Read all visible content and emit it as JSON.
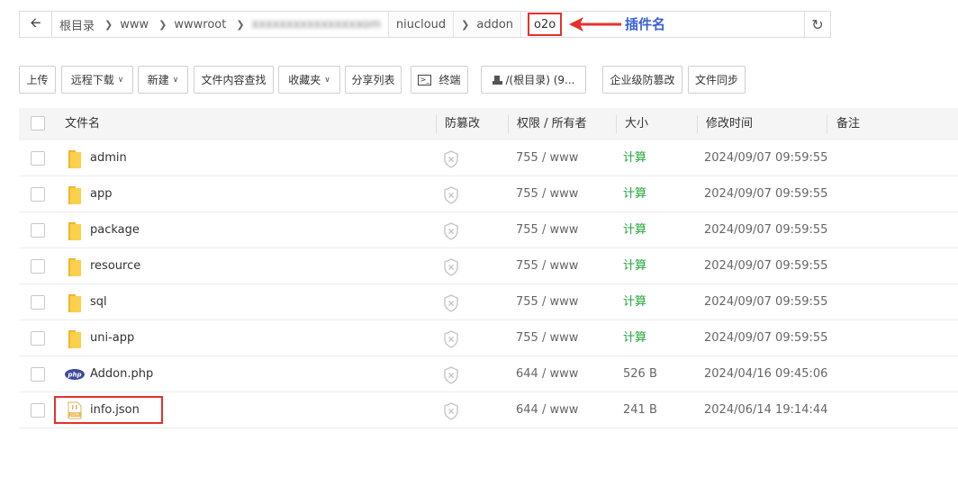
{
  "path": {
    "crumbs": [
      "根目录",
      "www",
      "wwwroot",
      "xxxxxxxxxxxxxxxxom",
      "niucloud",
      "addon",
      "o2o"
    ],
    "annotation": "插件名"
  },
  "toolbar": {
    "upload": "上传",
    "remote_download": "远程下载",
    "new": "新建",
    "content_search": "文件内容查找",
    "favorites": "收藏夹",
    "share_list": "分享列表",
    "terminal": "终端",
    "disk": "/(根目录) (9...",
    "tamper": "企业级防篡改",
    "sync": "文件同步"
  },
  "table": {
    "headers": {
      "name": "文件名",
      "tamper": "防篡改",
      "perm": "权限 / 所有者",
      "size": "大小",
      "mtime": "修改时间",
      "note": "备注"
    },
    "rows": [
      {
        "name": "admin",
        "type": "folder",
        "perm": "755 / www",
        "size": "计算",
        "mtime": "2024/09/07 09:59:55"
      },
      {
        "name": "app",
        "type": "folder",
        "perm": "755 / www",
        "size": "计算",
        "mtime": "2024/09/07 09:59:55"
      },
      {
        "name": "package",
        "type": "folder",
        "perm": "755 / www",
        "size": "计算",
        "mtime": "2024/09/07 09:59:55"
      },
      {
        "name": "resource",
        "type": "folder",
        "perm": "755 / www",
        "size": "计算",
        "mtime": "2024/09/07 09:59:55"
      },
      {
        "name": "sql",
        "type": "folder",
        "perm": "755 / www",
        "size": "计算",
        "mtime": "2024/09/07 09:59:55"
      },
      {
        "name": "uni-app",
        "type": "folder",
        "perm": "755 / www",
        "size": "计算",
        "mtime": "2024/09/07 09:59:55"
      },
      {
        "name": "Addon.php",
        "type": "php",
        "perm": "644 / www",
        "size": "526 B",
        "mtime": "2024/04/16 09:45:06"
      },
      {
        "name": "info.json",
        "type": "json",
        "perm": "644 / www",
        "size": "241 B",
        "mtime": "2024/06/14 19:14:44"
      }
    ]
  },
  "colors": {
    "folder": "#f5c842",
    "calc": "#20a53a",
    "highlight": "#e5312c",
    "annotation": "#3a62d6"
  }
}
